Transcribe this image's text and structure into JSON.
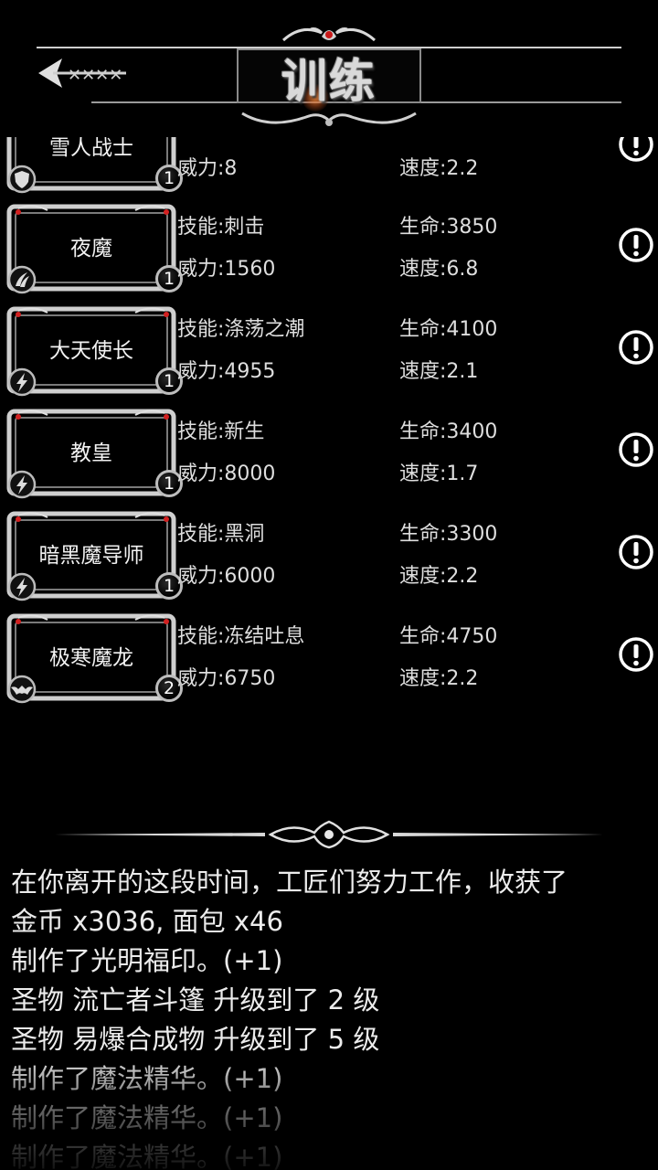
{
  "header": {
    "title": "训练",
    "back_icon": "ornate-arrow-left-icon"
  },
  "heroes": [
    {
      "name": "雪人战士",
      "skill": "",
      "hp": "",
      "power": "威力:8",
      "speed": "速度:2.2",
      "level": "1",
      "class_icon": "shield-icon"
    },
    {
      "name": "夜魔",
      "skill": "技能:刺击",
      "hp": "生命:3850",
      "power": "威力:1560",
      "speed": "速度:6.8",
      "level": "1",
      "class_icon": "claw-icon"
    },
    {
      "name": "大天使长",
      "skill": "技能:涤荡之潮",
      "hp": "生命:4100",
      "power": "威力:4955",
      "speed": "速度:2.1",
      "level": "1",
      "class_icon": "lightning-icon"
    },
    {
      "name": "教皇",
      "skill": "技能:新生",
      "hp": "生命:3400",
      "power": "威力:8000",
      "speed": "速度:1.7",
      "level": "1",
      "class_icon": "lightning-icon"
    },
    {
      "name": "暗黑魔导师",
      "skill": "技能:黑洞",
      "hp": "生命:3300",
      "power": "威力:6000",
      "speed": "速度:2.2",
      "level": "1",
      "class_icon": "lightning-icon"
    },
    {
      "name": "极寒魔龙",
      "skill": "技能:冻结吐息",
      "hp": "生命:4750",
      "power": "威力:6750",
      "speed": "速度:2.2",
      "level": "2",
      "class_icon": "bat-wing-icon"
    }
  ],
  "log": {
    "lines": [
      "在你离开的这段时间，工匠们努力工作，收获了",
      "金币 x3036, 面包 x46",
      "制作了光明福印。(+1)",
      "圣物 流亡者斗篷 升级到了 2 级",
      "圣物 易爆合成物 升级到了 5 级",
      "制作了魔法精华。(+1)",
      "制作了魔法精华。(+1)",
      "制作了魔法精华。(+1)"
    ]
  },
  "colors": {
    "background": "#000000",
    "text": "#e8e8e8",
    "frame_silver": "#c8c8c8",
    "gem_red": "#d22020"
  }
}
